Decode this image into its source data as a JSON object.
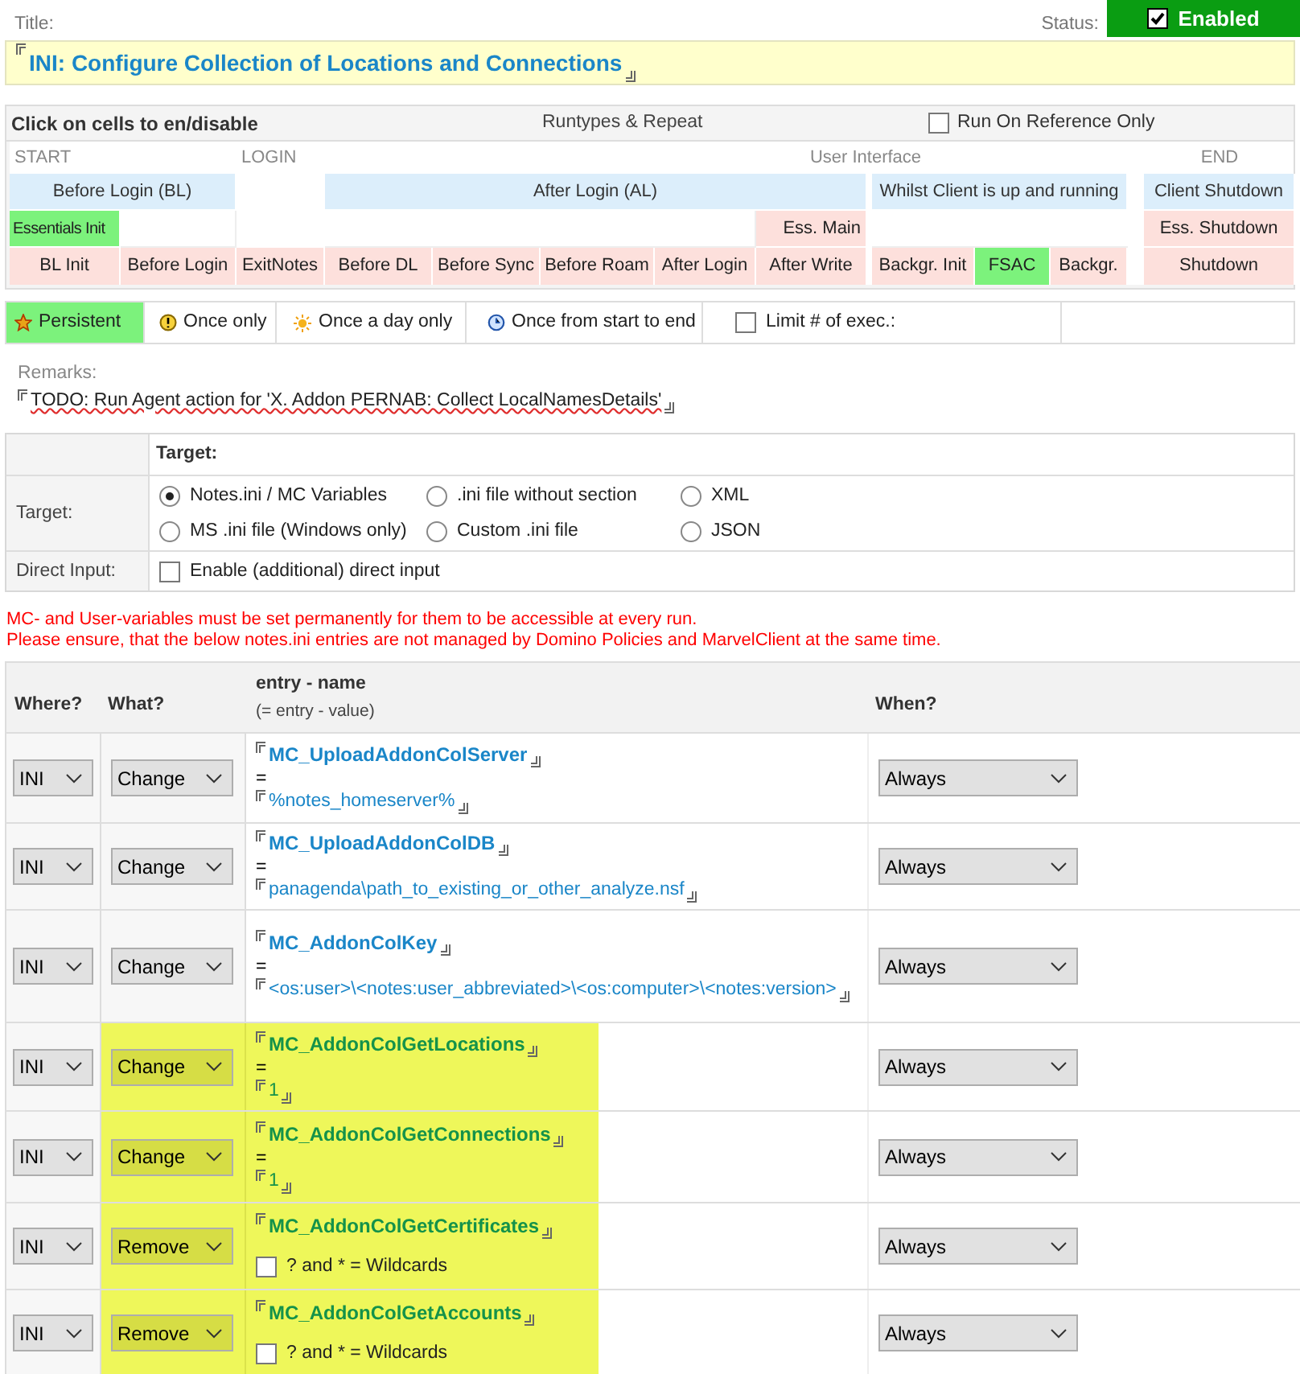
{
  "title_label": "Title:",
  "status": {
    "label": "Status:",
    "value": "Enabled",
    "checked": true
  },
  "title": "INI: Configure Collection of Locations and Connections",
  "runtypes": {
    "heading": "Click on cells to en/disable",
    "subheading": "Runtypes & Repeat",
    "run_on_reference_only": {
      "label": "Run On Reference Only",
      "checked": false
    },
    "phase_labels": [
      "START",
      "LOGIN",
      "User Interface",
      "END"
    ],
    "groups": [
      "Before Login (BL)",
      "After Login (AL)",
      "Whilst Client is up and running",
      "Client Shutdown"
    ],
    "essentials": [
      {
        "label": "Essentials Init",
        "on": true
      },
      {
        "label": "Ess. Main",
        "on": false
      },
      {
        "label": "Ess. Shutdown",
        "on": false
      }
    ],
    "events": [
      {
        "label": "BL Init",
        "on": false
      },
      {
        "label": "Before Login",
        "on": false
      },
      {
        "label": "ExitNotes",
        "on": false
      },
      {
        "label": "Before DL",
        "on": false
      },
      {
        "label": "Before Sync",
        "on": false
      },
      {
        "label": "Before Roam",
        "on": false
      },
      {
        "label": "After Login",
        "on": false
      },
      {
        "label": "After Write",
        "on": false
      },
      {
        "label": "Backgr. Init",
        "on": false
      },
      {
        "label": "FSAC",
        "on": true
      },
      {
        "label": "Backgr.",
        "on": false
      },
      {
        "label": "Shutdown",
        "on": false
      }
    ]
  },
  "repeat_options": [
    {
      "label": "Persistent",
      "selected": true
    },
    {
      "label": "Once only",
      "selected": false
    },
    {
      "label": "Once a day only",
      "selected": false
    },
    {
      "label": "Once from start to end",
      "selected": false
    }
  ],
  "limit_executions": {
    "label": "Limit # of exec.:",
    "checked": false
  },
  "remarks": {
    "label": "Remarks:",
    "value": "TODO: Run Agent action for 'X. Addon PERNAB: Collect LocalNamesDetails'"
  },
  "target": {
    "heading": "Target:",
    "label": "Target:",
    "options": [
      {
        "label": "Notes.ini / MC Variables",
        "selected": true
      },
      {
        "label": ".ini file without section",
        "selected": false
      },
      {
        "label": "XML",
        "selected": false
      },
      {
        "label": "MS .ini file (Windows only)",
        "selected": false
      },
      {
        "label": "Custom .ini file",
        "selected": false
      },
      {
        "label": "JSON",
        "selected": false
      }
    ]
  },
  "direct_input": {
    "label": "Direct Input:",
    "option": "Enable (additional) direct input",
    "checked": false
  },
  "warnings": [
    "MC- and User-variables must be set permanently for them to be accessible at every run.",
    "Please ensure, that the below notes.ini entries are not managed by Domino Policies and MarvelClient at the same time."
  ],
  "table": {
    "columns": [
      "Where?",
      "What?",
      "entry - name",
      "When?"
    ],
    "column_note": "(= entry - value)",
    "rows": [
      {
        "kind": "change",
        "where": "INI",
        "what": "Change",
        "name": "MC_UploadAddonColServer",
        "operator": "=",
        "value": "%notes_homeserver%",
        "when": "Always",
        "highlighted": false
      },
      {
        "kind": "change",
        "where": "INI",
        "what": "Change",
        "name": "MC_UploadAddonColDB",
        "operator": "=",
        "value": "panagenda\\path_to_existing_or_other_analyze.nsf",
        "when": "Always",
        "highlighted": false
      },
      {
        "kind": "change",
        "where": "INI",
        "what": "Change",
        "name": "MC_AddonColKey",
        "operator": "=",
        "value": "<os:user>\\<notes:user_abbreviated>\\<os:computer>\\<notes:version>",
        "when": "Always",
        "highlighted": false
      },
      {
        "kind": "change",
        "where": "INI",
        "what": "Change",
        "name": "MC_AddonColGetLocations",
        "operator": "=",
        "value": "1",
        "when": "Always",
        "highlighted": true
      },
      {
        "kind": "change",
        "where": "INI",
        "what": "Change",
        "name": "MC_AddonColGetConnections",
        "operator": "=",
        "value": "1",
        "when": "Always",
        "highlighted": true
      },
      {
        "kind": "remove",
        "where": "INI",
        "what": "Remove",
        "name": "MC_AddonColGetCertificates",
        "wildcards": {
          "label": "? and * = Wildcards",
          "checked": false
        },
        "when": "Always",
        "highlighted": true
      },
      {
        "kind": "remove",
        "where": "INI",
        "what": "Remove",
        "name": "MC_AddonColGetAccounts",
        "wildcards": {
          "label": "? and * = Wildcards",
          "checked": false
        },
        "when": "Always",
        "highlighted": true
      }
    ]
  }
}
